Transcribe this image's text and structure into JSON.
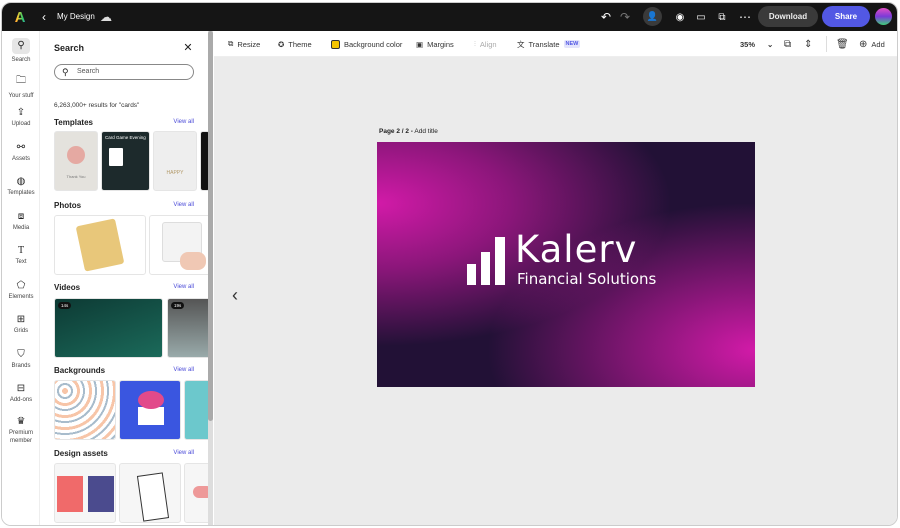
{
  "header": {
    "title": "My Design",
    "download": "Download",
    "share": "Share"
  },
  "toolbar": {
    "resize": "Resize",
    "theme": "Theme",
    "background_color": "Background color",
    "margins": "Margins",
    "align": "Align",
    "translate": "Translate",
    "new_badge": "NEW",
    "zoom": "35%",
    "add": "Add",
    "bg_swatch": "#f5c400"
  },
  "rail": [
    {
      "label": "Search"
    },
    {
      "label": "Your stuff"
    },
    {
      "label": "Upload"
    },
    {
      "label": "Assets"
    },
    {
      "label": "Templates"
    },
    {
      "label": "Media"
    },
    {
      "label": "Text"
    },
    {
      "label": "Elements"
    },
    {
      "label": "Grids"
    },
    {
      "label": "Brands"
    },
    {
      "label": "Add-ons"
    },
    {
      "label": "Premium member"
    }
  ],
  "panel": {
    "title": "Search",
    "search_placeholder": "Search",
    "results": "6,263,000+ results for \"cards\"",
    "view_all": "View all",
    "sections": [
      "Templates",
      "Photos",
      "Videos",
      "Backgrounds",
      "Design assets"
    ],
    "template_texts": [
      "Thank You",
      "Card Game Evening",
      "HAPPY"
    ],
    "video_durations": [
      "14s",
      "19s"
    ]
  },
  "page": {
    "label": "Page 2 / 2 -",
    "add_title": "Add title",
    "brand": "Kalerv",
    "tagline": "Financial Solutions"
  },
  "colors": {
    "accent": "#5258e4",
    "brand_bg": "#221136",
    "magenta": "#d21aa8"
  }
}
